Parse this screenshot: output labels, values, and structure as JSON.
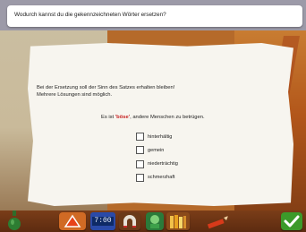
{
  "question": "Wodurch kannst du die gekennzeichneten Wörter ersetzen?",
  "instructions": [
    "Bei der Ersetzung soll der Sinn des Satzes erhalten bleiben!",
    "Mehrere Lösungen sind möglich."
  ],
  "sentence": {
    "before": "Es ist ",
    "highlight": "'böse'",
    "after": ", andere Menschen zu betrügen."
  },
  "options": [
    {
      "label": "hinterhältig",
      "checked": false
    },
    {
      "label": "gemein",
      "checked": false
    },
    {
      "label": "niederträchtig",
      "checked": false
    },
    {
      "label": "schmerzhaft",
      "checked": false
    }
  ],
  "toolbar": {
    "clock_text": "7:00",
    "icons": [
      "potion-bottle-icon",
      "helmet-icon",
      "clock-icon",
      "magnet-icon",
      "character-icon",
      "books-icon",
      "pencil-icon",
      "confirm-check-icon"
    ]
  },
  "colors": {
    "highlight": "#c62020",
    "banner_bg": "#9c9aa8",
    "confirm_green": "#3c9a2a"
  }
}
